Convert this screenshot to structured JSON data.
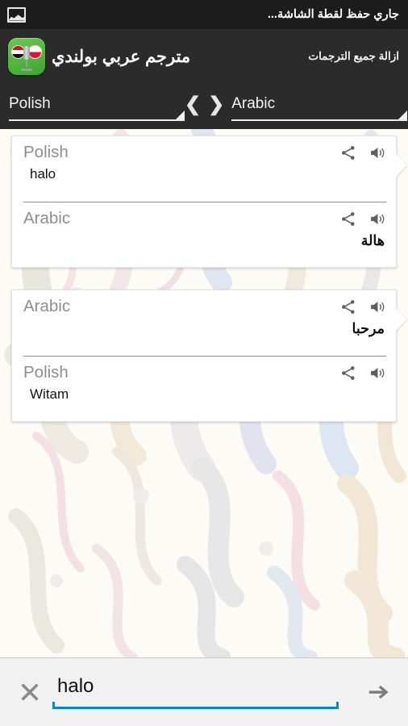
{
  "statusbar": {
    "notification_icon": "image-icon",
    "text": "جاري حفظ لقطة الشاشة..."
  },
  "actionbar": {
    "app_icon": "app-logo-icon",
    "title": "مترجم عربي بولندي",
    "clear_all_label": "ازالة جميع الترجمات"
  },
  "langbar": {
    "source": "Polish",
    "target": "Arabic",
    "swap_left_icon": "chevron-left-icon",
    "swap_right_icon": "chevron-right-icon",
    "chev_left": "❮",
    "chev_right": "❯"
  },
  "cards": [
    {
      "rows": [
        {
          "lang": "Polish",
          "text": "halo",
          "dir": "ltr",
          "share_icon": "share-icon",
          "speaker_icon": "speaker-icon"
        },
        {
          "lang": "Arabic",
          "text": "هالة",
          "dir": "rtl",
          "share_icon": "share-icon",
          "speaker_icon": "speaker-icon"
        }
      ]
    },
    {
      "rows": [
        {
          "lang": "Arabic",
          "text": "مرحبا",
          "dir": "rtl",
          "share_icon": "share-icon",
          "speaker_icon": "speaker-icon"
        },
        {
          "lang": "Polish",
          "text": "Witam",
          "dir": "ltr",
          "share_icon": "share-icon",
          "speaker_icon": "speaker-icon"
        }
      ]
    }
  ],
  "bottombar": {
    "clear_icon": "close-icon",
    "input_value": "halo",
    "input_placeholder": "",
    "submit_icon": "arrow-right-icon"
  },
  "colors": {
    "accent": "#0a87c4",
    "bar_dark": "#2b2b2b",
    "status_dark": "#1c1c1c",
    "label_gray": "#8e8e8e",
    "page_bg": "#fdfbf5",
    "bottom_bg": "#f1f1f1",
    "app_green": "#4fb83a"
  }
}
